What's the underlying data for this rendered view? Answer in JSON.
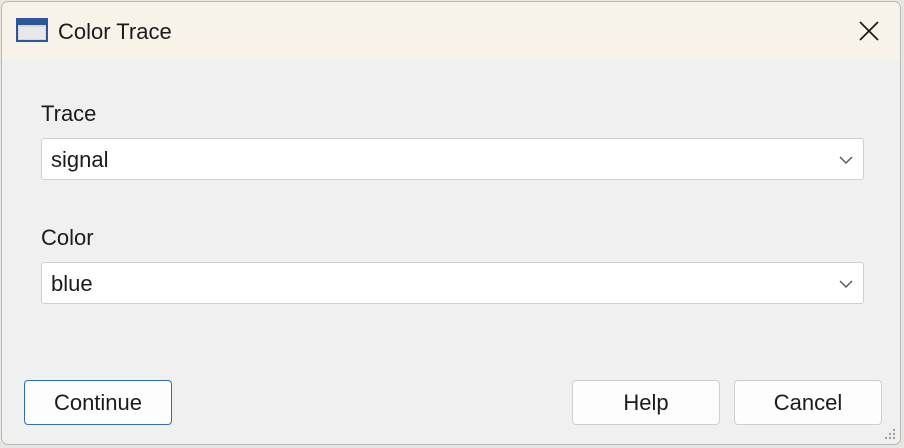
{
  "window": {
    "title": "Color Trace",
    "close_icon": "close-icon",
    "app_icon": "window-icon"
  },
  "form": {
    "trace": {
      "label": "Trace",
      "value": "signal"
    },
    "color": {
      "label": "Color",
      "value": "blue"
    }
  },
  "buttons": {
    "continue": "Continue",
    "help": "Help",
    "cancel": "Cancel"
  },
  "colors": {
    "titlebar": "#f8f3e9",
    "body": "#f0f0f0",
    "accent": "#2c6fb7"
  }
}
